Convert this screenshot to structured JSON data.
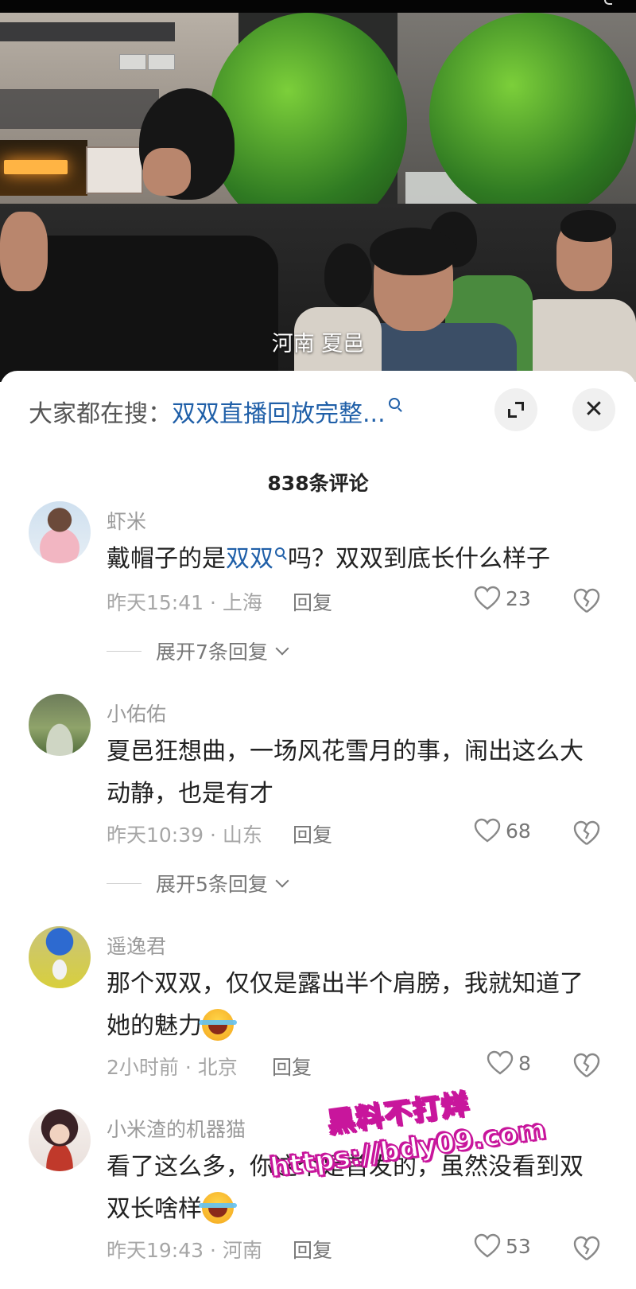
{
  "video": {
    "caption": "河南 夏邑"
  },
  "search": {
    "prefix": "大家都在搜：",
    "query": "双双直播回放完整..."
  },
  "comments_header": {
    "count_label": "838条评论"
  },
  "comments": [
    {
      "user": "虾米",
      "text_before": "戴帽子的是",
      "text_highlight": "双双",
      "text_after": "吗？双双到底长什么样子",
      "meta": "昨天15:41 · 上海",
      "reply": "回复",
      "likes": "23",
      "expand": "展开7条回复"
    },
    {
      "user": "小佑佑",
      "text": "夏邑狂想曲，一场风花雪月的事，闹出这么大动静，也是有才",
      "meta": "昨天10:39 · 山东",
      "reply": "回复",
      "likes": "68",
      "expand": "展开5条回复"
    },
    {
      "user": "遥逸君",
      "text": "那个双双，仅仅是露出半个肩膀，我就知道了她的魅力",
      "meta": "2小时前 · 北京",
      "reply": "回复",
      "likes": "8"
    },
    {
      "user": "小米渣的机器猫",
      "text": "看了这么多，你这个是首发的，虽然没看到双双长啥样",
      "meta": "昨天19:43 · 河南",
      "reply": "回复",
      "likes": "53"
    }
  ],
  "watermark": {
    "line1": "黑料不打烊",
    "line2": "https://bdy09.com"
  },
  "icons": {
    "search": "search-icon",
    "expand": "expand-icon",
    "close": "close-icon",
    "like": "heart-icon",
    "dislike": "broken-heart-icon",
    "chevron": "chevron-down-icon"
  },
  "colors": {
    "link": "#1f5fa8",
    "muted": "#9a9a9a",
    "text": "#222222"
  }
}
